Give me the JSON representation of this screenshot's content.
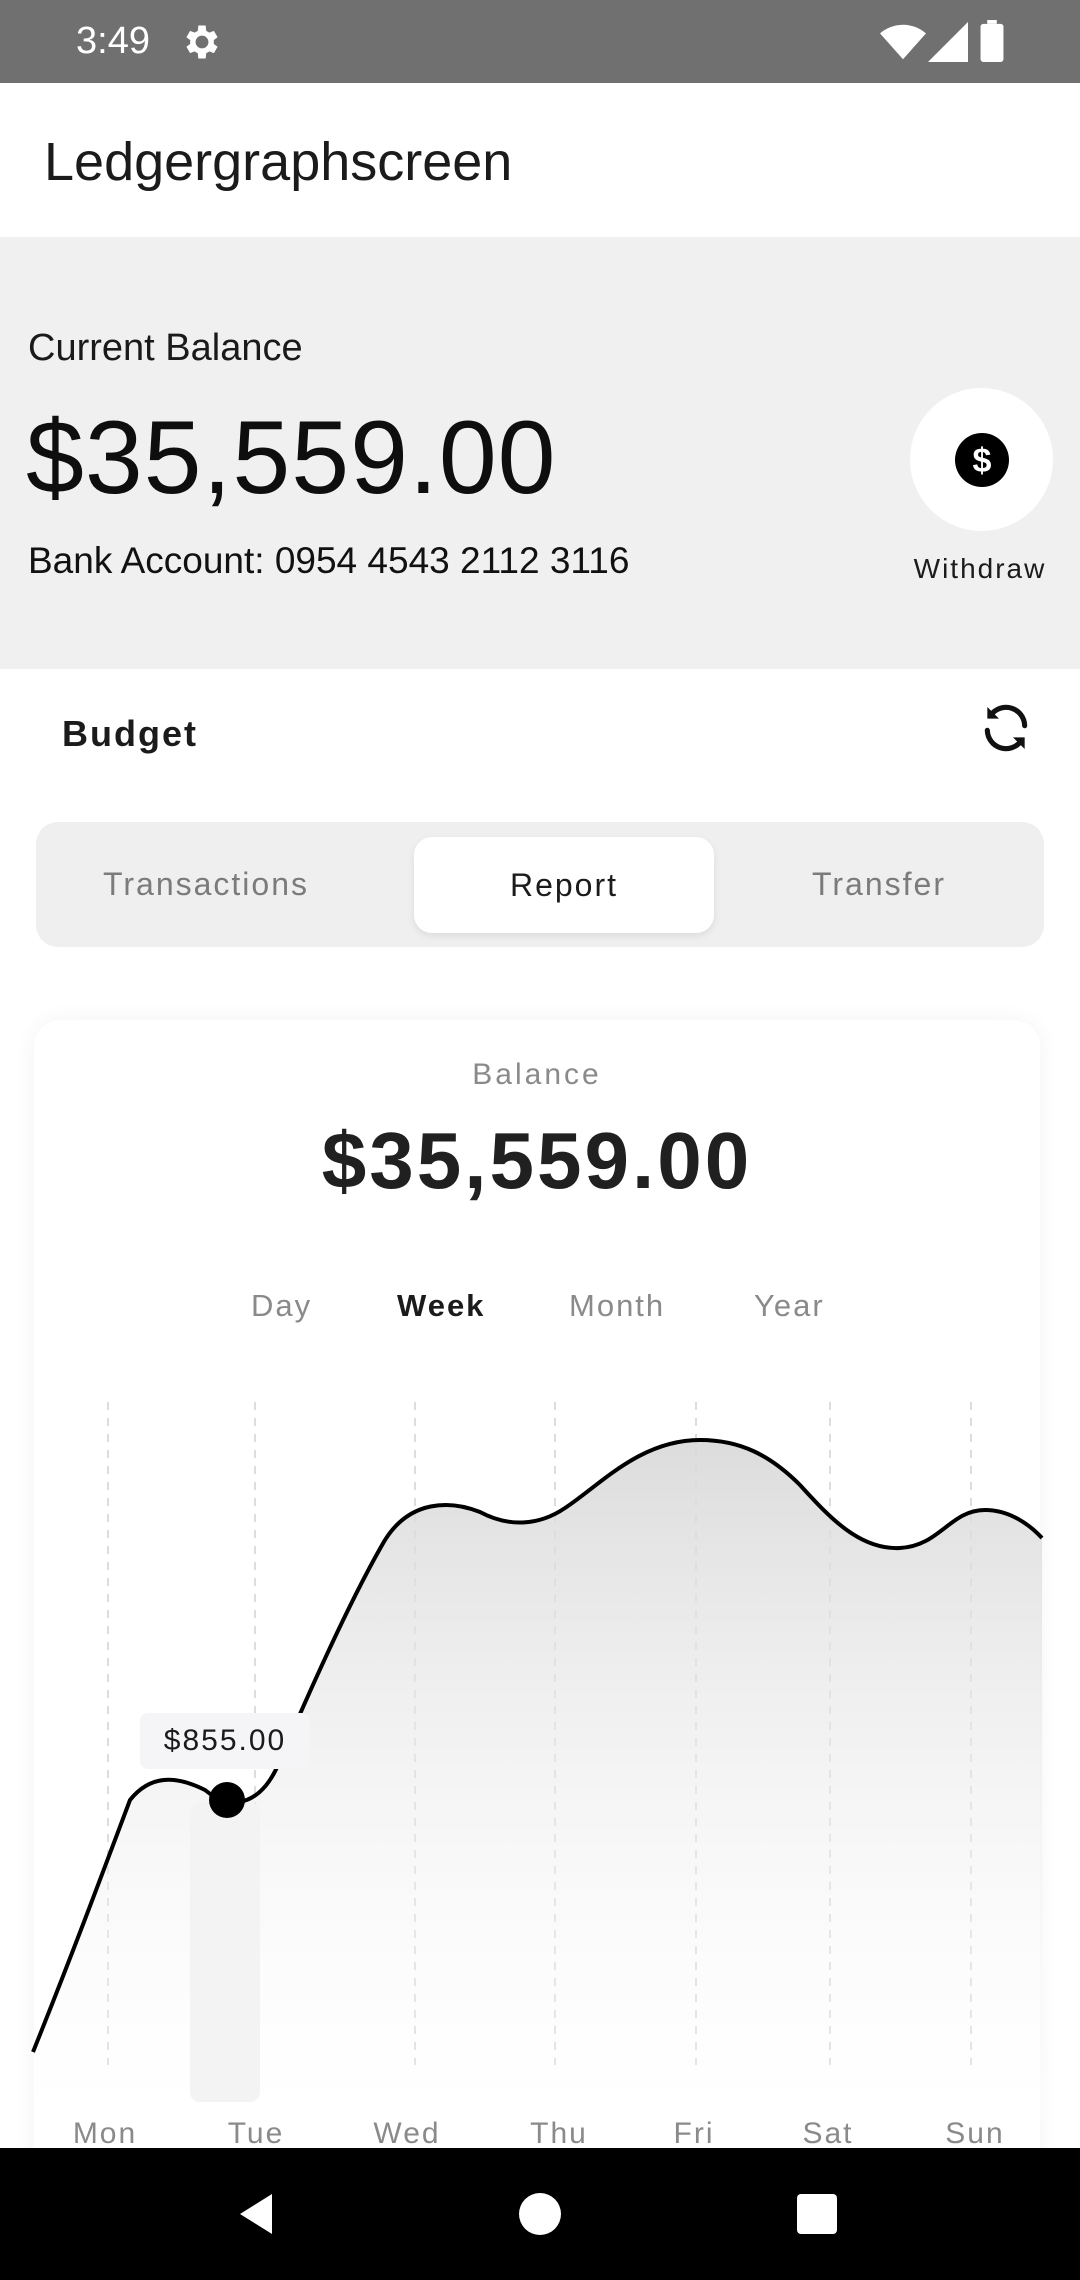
{
  "status_bar": {
    "time": "3:49"
  },
  "app_bar": {
    "title": "Ledgergraphscreen"
  },
  "balance_header": {
    "label": "Current Balance",
    "amount": "$35,559.00",
    "account": "Bank Account: 0954 4543 2112 3116",
    "withdraw_label": "Withdraw"
  },
  "budget": {
    "title": "Budget"
  },
  "tabs": [
    {
      "label": "Transactions",
      "active": false
    },
    {
      "label": "Report",
      "active": true
    },
    {
      "label": "Transfer",
      "active": false
    }
  ],
  "card": {
    "label": "Balance",
    "amount": "$35,559.00",
    "periods": [
      {
        "label": "Day",
        "active": false
      },
      {
        "label": "Week",
        "active": true
      },
      {
        "label": "Month",
        "active": false
      },
      {
        "label": "Year",
        "active": false
      }
    ]
  },
  "chart_data": {
    "type": "area",
    "categories": [
      "Mon",
      "Tue",
      "Wed",
      "Thu",
      "Fri",
      "Sat",
      "Sun"
    ],
    "selected": {
      "category": "Tue",
      "label": "$855.00"
    }
  },
  "colors": {
    "accent": "#000000",
    "header_bg": "#f0f0f0",
    "status_bar": "#707070"
  }
}
